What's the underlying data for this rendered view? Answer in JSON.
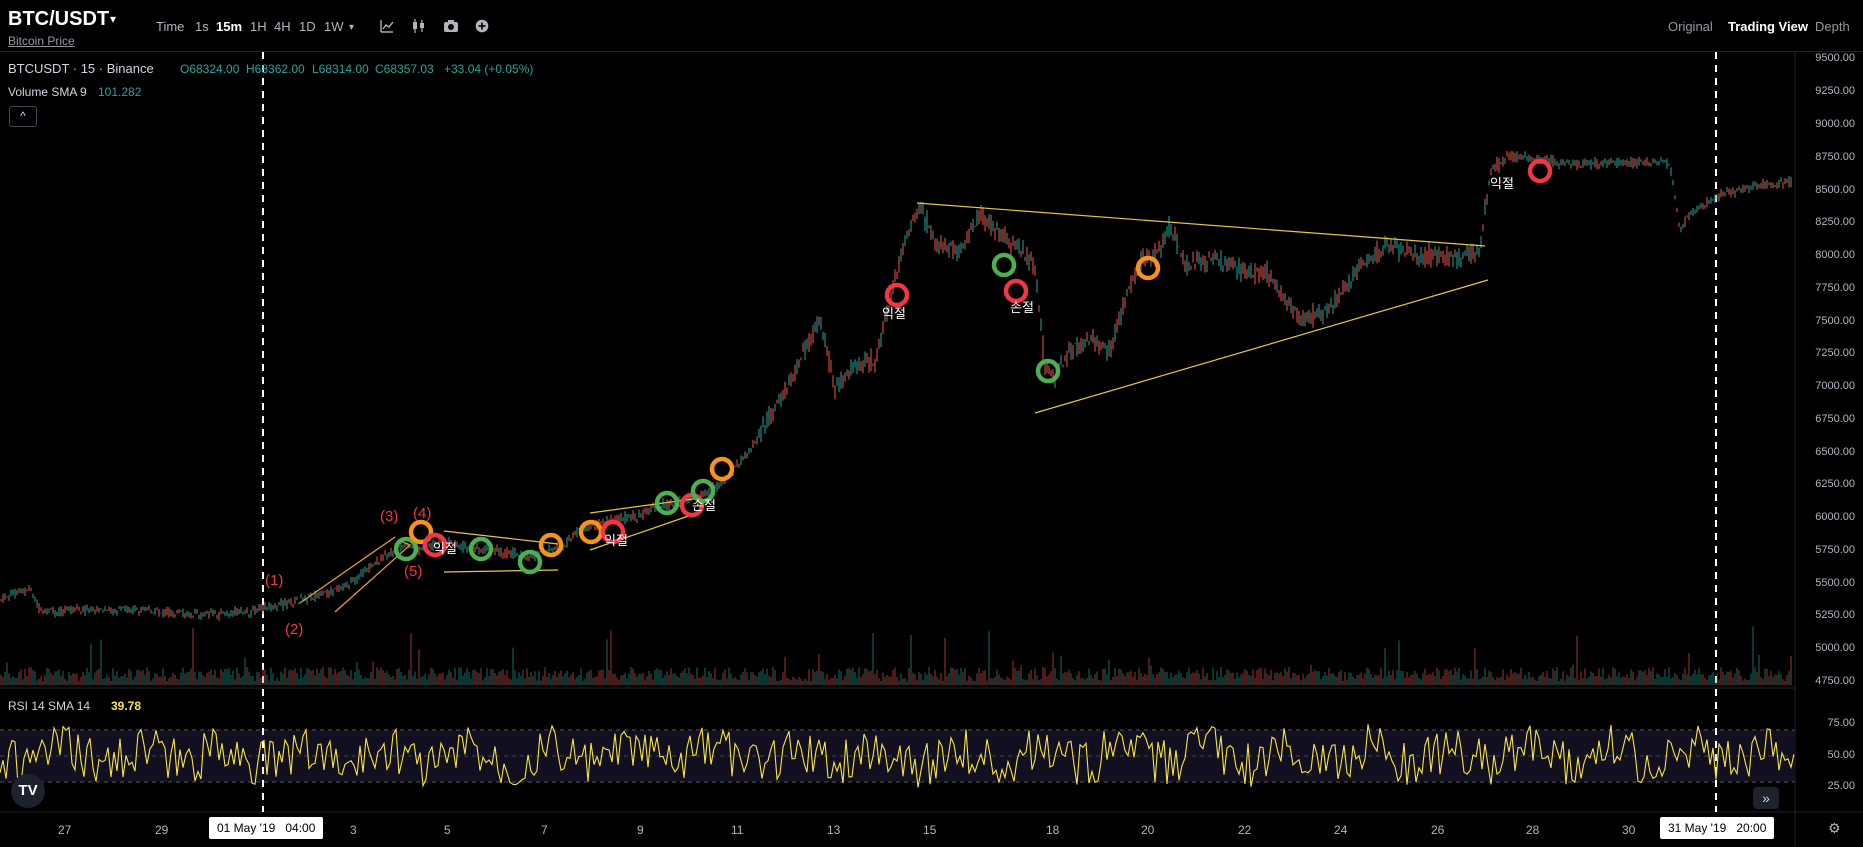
{
  "header": {
    "symbol": "BTC/USDT",
    "symbol_caret": "▾",
    "subtitle_link": "Bitcoin Price",
    "timeframes": [
      "Time",
      "1s",
      "15m",
      "1H",
      "4H",
      "1D",
      "1W"
    ],
    "active_timeframe": "15m",
    "more_caret": "▾",
    "tools": [
      "indicator-icon",
      "candles-icon",
      "camera-icon",
      "plus-circle-icon"
    ],
    "view_modes": [
      "Original",
      "Trading View",
      "Depth"
    ],
    "active_view": "Trading View"
  },
  "legend": {
    "title": "BTCUSDT · 15 · Binance",
    "open": "O68324.00",
    "high": "H68362.00",
    "low": "L68314.00",
    "close": "C68357.03",
    "change": "+33.04 (+0.05%)",
    "volume_label": "Volume SMA 9",
    "volume_value": "101.282",
    "collapse": "^"
  },
  "price_axis": [
    "9500.00",
    "9250.00",
    "9000.00",
    "8750.00",
    "8500.00",
    "8250.00",
    "8000.00",
    "7750.00",
    "7500.00",
    "7250.00",
    "7000.00",
    "6750.00",
    "6500.00",
    "6250.00",
    "6000.00",
    "5750.00",
    "5500.00",
    "5250.00",
    "5000.00",
    "4750.00"
  ],
  "rsi": {
    "label": "RSI 14 SMA 14",
    "value": "39.78",
    "axis": [
      "75.00",
      "50.00",
      "25.00"
    ]
  },
  "time_axis": [
    "27",
    "29",
    "3",
    "5",
    "7",
    "9",
    "11",
    "13",
    "15",
    "18",
    "20",
    "22",
    "24",
    "26",
    "28",
    "30"
  ],
  "time_highlights": {
    "left_date": "01 May '19",
    "left_time": "04:00",
    "right_date": "31 May '19",
    "right_time": "20:00"
  },
  "annotations": {
    "wave_labels": [
      "(1)",
      "(2)",
      "(3)",
      "(4)",
      "(5)"
    ],
    "korean": [
      "익절",
      "익절",
      "손절",
      "익절",
      "손절",
      "익절"
    ]
  },
  "colors": {
    "background": "#000000",
    "up": "#26a69a",
    "down": "#ef5350",
    "trendline": "#e6c83a",
    "wave_line": "#f0a030",
    "marker_green": "#4caf50",
    "marker_red": "#f23645",
    "marker_orange": "#f7931a",
    "rsi_line": "#f5e642"
  },
  "footer": {
    "logo": "TV",
    "scroll": "»",
    "settings_icon": "⚙"
  }
}
